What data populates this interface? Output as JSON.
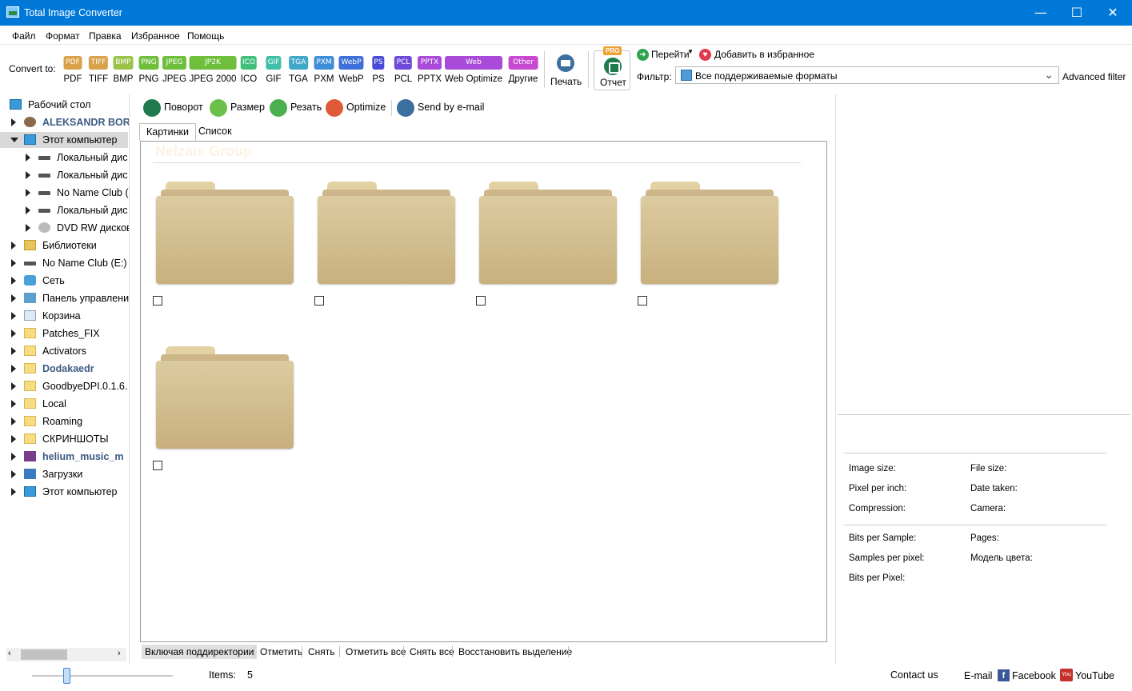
{
  "window": {
    "title": "Total Image Converter"
  },
  "menu": [
    "Файл",
    "Формат",
    "Правка",
    "Избранное",
    "Помощь"
  ],
  "toolbar": {
    "convert_label": "Convert to:",
    "formats": [
      {
        "badge": "PDF",
        "label": "PDF",
        "color": "#d8a24a"
      },
      {
        "badge": "TIFF",
        "label": "TIFF",
        "color": "#d8a24a"
      },
      {
        "badge": "BMP",
        "label": "BMP",
        "color": "#9bc34a"
      },
      {
        "badge": "PNG",
        "label": "PNG",
        "color": "#6fbf3d"
      },
      {
        "badge": "JPEG",
        "label": "JPEG",
        "color": "#6fbf3d"
      },
      {
        "badge": "JP2K",
        "label": "JPEG 2000",
        "color": "#6fbf3d"
      },
      {
        "badge": "ICO",
        "label": "ICO",
        "color": "#3fbf7a"
      },
      {
        "badge": "GIF",
        "label": "GIF",
        "color": "#3fbfa8"
      },
      {
        "badge": "TGA",
        "label": "TGA",
        "color": "#3fa8c8"
      },
      {
        "badge": "PXM",
        "label": "PXM",
        "color": "#3f8ed8"
      },
      {
        "badge": "WebP",
        "label": "WebP",
        "color": "#3f6fd8"
      },
      {
        "badge": "PS",
        "label": "PS",
        "color": "#4a4ad8"
      },
      {
        "badge": "PCL",
        "label": "PCL",
        "color": "#6f4ad8"
      },
      {
        "badge": "PPTX",
        "label": "PPTX",
        "color": "#a94ad8"
      },
      {
        "badge": "Web",
        "label": "Web Optimize",
        "color": "#a94ad8"
      },
      {
        "badge": "Other",
        "label": "Другие",
        "color": "#c84ad0"
      }
    ],
    "print_label": "Печать",
    "report_label": "Отчет",
    "pro_badge": "PRO",
    "goto_label": "Перейти",
    "favorites_label": "Добавить в избранное",
    "filter_label": "Фильтр:",
    "filter_value": "Все поддерживаемые форматы",
    "advanced_filter": "Advanced filter"
  },
  "tree": [
    {
      "label": "Рабочий стол",
      "level": 0,
      "arrow": "none",
      "icon": "monitor",
      "bold": false
    },
    {
      "label": "ALEKSANDR BOR",
      "level": 1,
      "arrow": "right",
      "icon": "user",
      "bold": true
    },
    {
      "label": "Этот компьютер",
      "level": 1,
      "arrow": "down",
      "icon": "monitor",
      "bold": false,
      "selected": true
    },
    {
      "label": "Локальный дис",
      "level": 2,
      "arrow": "right",
      "icon": "drive",
      "bold": false
    },
    {
      "label": "Локальный дис",
      "level": 2,
      "arrow": "right",
      "icon": "drive",
      "bold": false
    },
    {
      "label": "No Name Club (",
      "level": 2,
      "arrow": "right",
      "icon": "drive",
      "bold": false
    },
    {
      "label": "Локальный дис",
      "level": 2,
      "arrow": "right",
      "icon": "drive",
      "bold": false
    },
    {
      "label": "DVD RW дисков",
      "level": 2,
      "arrow": "right",
      "icon": "dvd",
      "bold": false
    },
    {
      "label": "Библиотеки",
      "level": 1,
      "arrow": "right",
      "icon": "lib",
      "bold": false
    },
    {
      "label": "No Name Club (E:)",
      "level": 1,
      "arrow": "right",
      "icon": "drive",
      "bold": false
    },
    {
      "label": "Сеть",
      "level": 1,
      "arrow": "right",
      "icon": "net",
      "bold": false
    },
    {
      "label": "Панель управлени",
      "level": 1,
      "arrow": "right",
      "icon": "panel",
      "bold": false
    },
    {
      "label": "Корзина",
      "level": 1,
      "arrow": "right",
      "icon": "trash",
      "bold": false
    },
    {
      "label": "Patches_FIX",
      "level": 1,
      "arrow": "right",
      "icon": "folder",
      "bold": false
    },
    {
      "label": "Activators",
      "level": 1,
      "arrow": "right",
      "icon": "folder",
      "bold": false
    },
    {
      "label": "Dodakaedr",
      "level": 1,
      "arrow": "right",
      "icon": "folder",
      "bold": true
    },
    {
      "label": "GoodbyeDPI.0.1.6.",
      "level": 1,
      "arrow": "right",
      "icon": "folder",
      "bold": false
    },
    {
      "label": "Local",
      "level": 1,
      "arrow": "right",
      "icon": "folder",
      "bold": false
    },
    {
      "label": "Roaming",
      "level": 1,
      "arrow": "right",
      "icon": "folder",
      "bold": false
    },
    {
      "label": "СКРИНШОТЫ",
      "level": 1,
      "arrow": "right",
      "icon": "folder",
      "bold": false
    },
    {
      "label": "helium_music_m",
      "level": 1,
      "arrow": "right",
      "icon": "rar",
      "bold": true
    },
    {
      "label": "Загрузки",
      "level": 1,
      "arrow": "right",
      "icon": "dl",
      "bold": false
    },
    {
      "label": "Этот компьютер",
      "level": 1,
      "arrow": "right",
      "icon": "monitor",
      "bold": false
    }
  ],
  "actions": [
    {
      "label": "Поворот",
      "color": "#1f7a4d",
      "icon": "rotate-icon"
    },
    {
      "label": "Размер",
      "color": "#6cc04a",
      "icon": "resize-icon"
    },
    {
      "label": "Резать",
      "color": "#4caf50",
      "icon": "crop-icon"
    },
    {
      "label": "Optimize",
      "color": "#e05a3a",
      "icon": "optimize-icon"
    },
    {
      "label": "Send by e-mail",
      "color": "#3d6f9e",
      "icon": "email-icon"
    }
  ],
  "tabs": [
    "Картинки",
    "Список"
  ],
  "content": {
    "watermark": "Nelzais Group",
    "folders": 5
  },
  "bottom_actions": [
    "Включая поддиректории",
    "Отметить",
    "Снять",
    "Отметить все",
    "Снять все",
    "Восстановить выделение"
  ],
  "info": {
    "image_size": "Image size:",
    "file_size": "File size:",
    "ppi": "Pixel per inch:",
    "date_taken": "Date taken:",
    "compression": "Compression:",
    "camera": "Camera:",
    "bits_per_sample": "Bits per Sample:",
    "pages": "Pages:",
    "samples_per_pixel": "Samples per pixel:",
    "color_model": "Модель цвета:",
    "bits_per_pixel": "Bits per Pixel:"
  },
  "status": {
    "items_label": "Items:",
    "items_count": "5",
    "contact": "Contact us",
    "email": "E-mail",
    "facebook": "Facebook",
    "youtube": "YouTube"
  }
}
